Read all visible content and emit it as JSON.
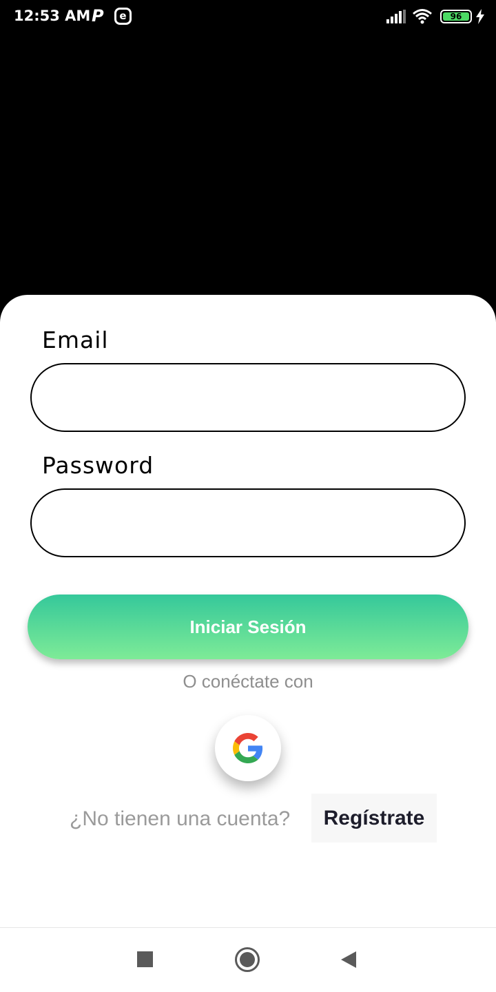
{
  "status_bar": {
    "time": "12:53 AM",
    "app_icon_p": "P",
    "app_icon_e": "e",
    "battery_level": "96",
    "icons": [
      "signal-icon",
      "wifi-icon",
      "battery-icon",
      "charging-icon"
    ]
  },
  "login_form": {
    "email_label": "Email",
    "email_value": "",
    "password_label": "Password",
    "password_value": "",
    "submit_label": "Iniciar Sesión",
    "alt_login_text": "O conéctate con",
    "google_icon": "google-icon",
    "register_prompt": "¿No tienen una cuenta?",
    "register_label": "Regístrate"
  },
  "colors": {
    "button_gradient_top": "#35c89a",
    "button_gradient_bottom": "#7eeb97",
    "muted_text": "#8e8e8e",
    "background": "#000000",
    "card": "#ffffff"
  },
  "nav_bar": {
    "icons": [
      "recents-icon",
      "home-icon",
      "back-icon"
    ]
  }
}
